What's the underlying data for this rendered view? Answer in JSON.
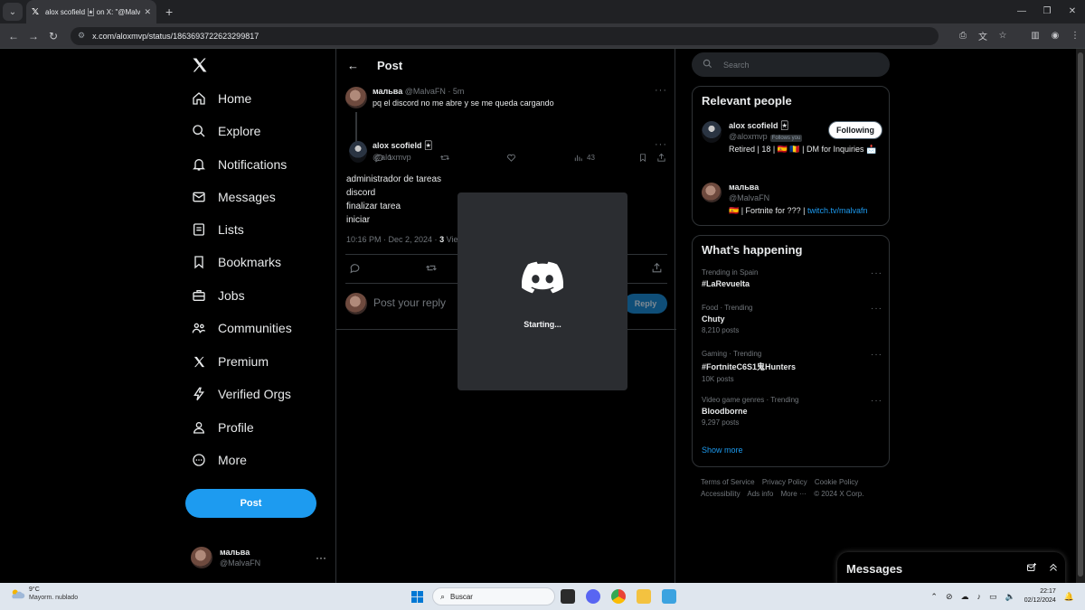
{
  "browser": {
    "tab_title": "alox scofield 🃏 on X: \"@MalvaFN",
    "url": "x.com/aloxmvp/status/1863693722623299817"
  },
  "nav": {
    "items": [
      {
        "label": "Home",
        "icon": "home-icon"
      },
      {
        "label": "Explore",
        "icon": "search-icon"
      },
      {
        "label": "Notifications",
        "icon": "bell-icon"
      },
      {
        "label": "Messages",
        "icon": "envelope-icon"
      },
      {
        "label": "Lists",
        "icon": "list-icon"
      },
      {
        "label": "Bookmarks",
        "icon": "bookmark-icon"
      },
      {
        "label": "Jobs",
        "icon": "briefcase-icon"
      },
      {
        "label": "Communities",
        "icon": "people-icon"
      },
      {
        "label": "Premium",
        "icon": "x-icon"
      },
      {
        "label": "Verified Orgs",
        "icon": "lightning-icon"
      },
      {
        "label": "Profile",
        "icon": "person-icon"
      },
      {
        "label": "More",
        "icon": "more-circle-icon"
      }
    ],
    "post_label": "Post",
    "account": {
      "name": "мальва",
      "handle": "@MalvaFN"
    }
  },
  "main": {
    "title": "Post",
    "parent_tweet": {
      "name": "мальва",
      "handle": "@MalvaFN",
      "dot": "·",
      "time": "5m",
      "text": "pq el discord no me abre y se me queda cargando",
      "replies": "1",
      "views": "43"
    },
    "tweet": {
      "name": "alox scofield 🃏",
      "handle": "@aloxmvp",
      "lines": [
        "administrador de tareas",
        "discord",
        "finalizar tarea",
        "iniciar"
      ],
      "datetime": "10:16 PM · Dec 2, 2024 ·",
      "views_count": "3",
      "views_label": "Vie"
    },
    "reply_placeholder": "Post your reply",
    "reply_button": "Reply"
  },
  "right": {
    "search_placeholder": "Search",
    "relevant_title": "Relevant people",
    "people": [
      {
        "name": "alox scofield 🃏",
        "handle": "@aloxmvp",
        "follows_you": "Follows you",
        "bio": "Retired | 18 | 🇪🇸 🇷🇴 | DM for Inquiries 📩",
        "button": "Following"
      },
      {
        "name": "мальва",
        "handle": "@MalvaFN",
        "bio_prefix": "🇪🇸 | Fortnite for ??? |",
        "bio_link": "twitch.tv/malvafn"
      }
    ],
    "happening_title": "What’s happening",
    "trends": [
      {
        "context": "Trending in Spain",
        "name": "#LaRevuelta",
        "count": ""
      },
      {
        "context": "Food · Trending",
        "name": "Chuty",
        "count": "8,210 posts"
      },
      {
        "context": "Gaming · Trending",
        "name": "#FortniteC6S1鬼Hunters",
        "count": "10K posts"
      },
      {
        "context": "Video game genres · Trending",
        "name": "Bloodborne",
        "count": "9,297 posts"
      }
    ],
    "show_more": "Show more",
    "footer": [
      "Terms of Service",
      "Privacy Policy",
      "Cookie Policy",
      "Accessibility",
      "Ads info",
      "More ···",
      "© 2024 X Corp."
    ]
  },
  "messages_drawer": {
    "title": "Messages"
  },
  "discord": {
    "status": "Starting..."
  },
  "taskbar": {
    "weather_temp": "9°C",
    "weather_desc": "Mayorm. nublado",
    "search_placeholder": "Buscar",
    "time": "22:17",
    "date": "02/12/2024"
  },
  "colors": {
    "accent": "#1d9bf0",
    "background": "#000000",
    "discord_bg": "#2b2d31",
    "discord_blurple": "#ffffff"
  }
}
